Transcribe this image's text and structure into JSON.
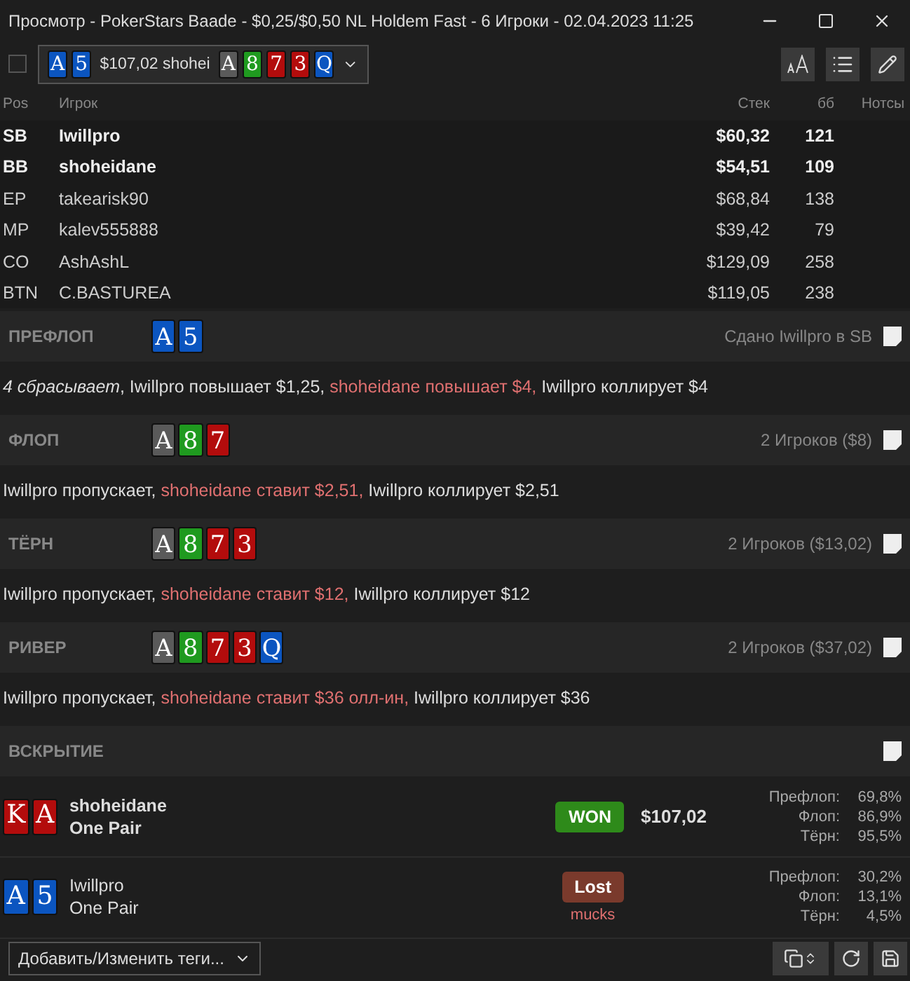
{
  "window": {
    "title": "Просмотр - PokerStars Baade - $0,25/$0,50 NL Holdem Fast - 6 Игроки - 02.04.2023 11:25"
  },
  "hand_selector": {
    "checked": false,
    "hole_cards": [
      {
        "rank": "A",
        "color": "#0b55c0"
      },
      {
        "rank": "5",
        "color": "#0b55c0"
      }
    ],
    "text": "$107,02 shohei",
    "board": [
      {
        "rank": "A",
        "color": "#5a5a5a"
      },
      {
        "rank": "8",
        "color": "#1f9a1f"
      },
      {
        "rank": "7",
        "color": "#b30c0c"
      },
      {
        "rank": "3",
        "color": "#b30c0c"
      },
      {
        "rank": "Q",
        "color": "#0b55c0"
      }
    ]
  },
  "players_table": {
    "columns": [
      "Pos",
      "Игрок",
      "Стек",
      "бб",
      "Нотсы"
    ],
    "rows": [
      {
        "pos": "SB",
        "player": "Iwillpro",
        "stack": "$60,32",
        "bb": "121",
        "in_hand": true
      },
      {
        "pos": "BB",
        "player": "shoheidane",
        "stack": "$54,51",
        "bb": "109",
        "in_hand": true
      },
      {
        "pos": "EP",
        "player": "takearisk90",
        "stack": "$68,84",
        "bb": "138",
        "in_hand": false
      },
      {
        "pos": "MP",
        "player": "kalev555888",
        "stack": "$39,42",
        "bb": "79",
        "in_hand": false
      },
      {
        "pos": "CO",
        "player": "AshAshL",
        "stack": "$129,09",
        "bb": "258",
        "in_hand": false
      },
      {
        "pos": "BTN",
        "player": "C.BASTUREA",
        "stack": "$119,05",
        "bb": "238",
        "in_hand": false
      }
    ]
  },
  "streets": [
    {
      "name": "ПРЕФЛОП",
      "cards": [
        {
          "rank": "A",
          "color": "#0b55c0"
        },
        {
          "rank": "5",
          "color": "#0b55c0"
        }
      ],
      "info": "Сдано Iwillpro в SB",
      "actions": [
        {
          "kind": "italic",
          "text": "4 сбрасывает"
        },
        {
          "kind": "plain",
          "text": ", Iwillpro повышает $1,25, "
        },
        {
          "kind": "hero",
          "text": "shoheidane повышает $4,"
        },
        {
          "kind": "plain",
          "text": " Iwillpro коллирует $4"
        }
      ]
    },
    {
      "name": "ФЛОП",
      "cards": [
        {
          "rank": "A",
          "color": "#5a5a5a"
        },
        {
          "rank": "8",
          "color": "#1f9a1f"
        },
        {
          "rank": "7",
          "color": "#b30c0c"
        }
      ],
      "info": "2 Игроков ($8)",
      "actions": [
        {
          "kind": "plain",
          "text": "Iwillpro пропускает, "
        },
        {
          "kind": "hero",
          "text": "shoheidane ставит $2,51,"
        },
        {
          "kind": "plain",
          "text": " Iwillpro коллирует $2,51"
        }
      ]
    },
    {
      "name": "ТЁРН",
      "cards": [
        {
          "rank": "A",
          "color": "#5a5a5a"
        },
        {
          "rank": "8",
          "color": "#1f9a1f"
        },
        {
          "rank": "7",
          "color": "#b30c0c"
        },
        {
          "rank": "3",
          "color": "#b30c0c"
        }
      ],
      "info": "2 Игроков ($13,02)",
      "actions": [
        {
          "kind": "plain",
          "text": "Iwillpro пропускает, "
        },
        {
          "kind": "hero",
          "text": "shoheidane ставит $12,"
        },
        {
          "kind": "plain",
          "text": " Iwillpro коллирует $12"
        }
      ]
    },
    {
      "name": "РИВЕР",
      "cards": [
        {
          "rank": "A",
          "color": "#5a5a5a"
        },
        {
          "rank": "8",
          "color": "#1f9a1f"
        },
        {
          "rank": "7",
          "color": "#b30c0c"
        },
        {
          "rank": "3",
          "color": "#b30c0c"
        },
        {
          "rank": "Q",
          "color": "#0b55c0"
        }
      ],
      "info": "2 Игроков ($37,02)",
      "actions": [
        {
          "kind": "plain",
          "text": "Iwillpro пропускает, "
        },
        {
          "kind": "hero",
          "text": "shoheidane ставит $36 олл-ин,"
        },
        {
          "kind": "plain",
          "text": " Iwillpro коллирует $36"
        }
      ]
    }
  ],
  "showdown": {
    "title": "ВСКРЫТИЕ",
    "players": [
      {
        "cards": [
          {
            "rank": "K",
            "color": "#b30c0c"
          },
          {
            "rank": "A",
            "color": "#b30c0c"
          }
        ],
        "name": "shoheidane",
        "hand": "One Pair",
        "winner": true,
        "result": "WON",
        "amount": "$107,02",
        "equity": [
          {
            "street": "Префлоп:",
            "value": "69,8%"
          },
          {
            "street": "Флоп:",
            "value": "86,9%"
          },
          {
            "street": "Тёрн:",
            "value": "95,5%"
          }
        ]
      },
      {
        "cards": [
          {
            "rank": "A",
            "color": "#0b55c0"
          },
          {
            "rank": "5",
            "color": "#0b55c0"
          }
        ],
        "name": "Iwillpro",
        "hand": "One Pair",
        "winner": false,
        "result": "Lost",
        "note": "mucks",
        "equity": [
          {
            "street": "Префлоп:",
            "value": "30,2%"
          },
          {
            "street": "Флоп:",
            "value": "13,1%"
          },
          {
            "street": "Тёрн:",
            "value": "4,5%"
          }
        ]
      }
    ]
  },
  "tags_dropdown": {
    "label": "Добавить/Изменить теги..."
  }
}
